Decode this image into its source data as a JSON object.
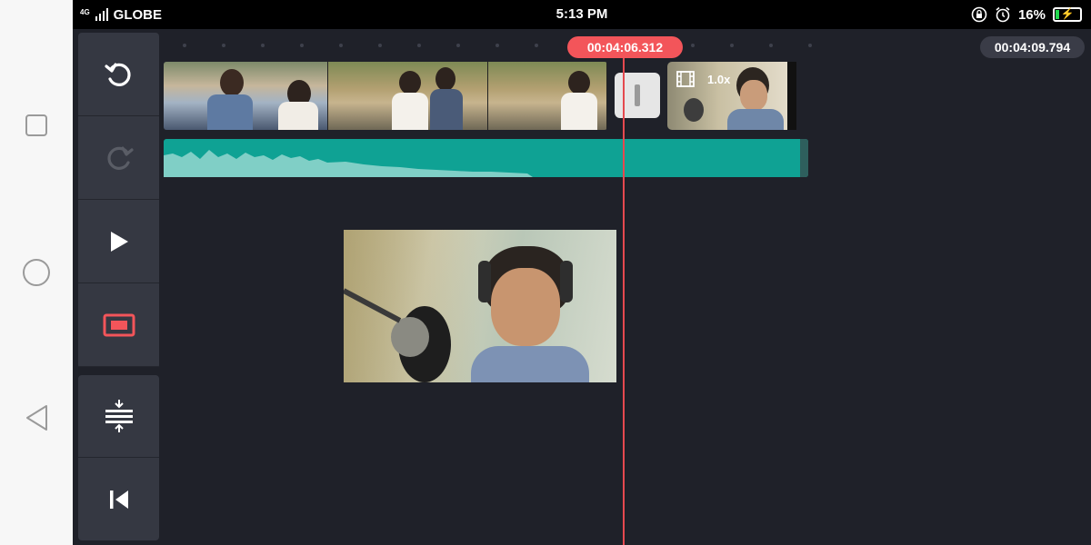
{
  "status_bar": {
    "network": "4G",
    "carrier": "GLOBE",
    "time": "5:13 PM",
    "battery_percent": "16%",
    "battery_level": 0.16
  },
  "timeline": {
    "playhead_time": "00:04:06.312",
    "total_time": "00:04:09.794",
    "clip_speed": "1.0x"
  },
  "tools": {
    "items": [
      "undo-icon",
      "redo-icon",
      "play-icon",
      "fullscreen-preview-icon",
      "split-icon",
      "skip-to-start-icon"
    ]
  },
  "colors": {
    "accent": "#f3555a",
    "audio": "#0fa294",
    "panel": "#353842",
    "background": "#1f2129"
  }
}
